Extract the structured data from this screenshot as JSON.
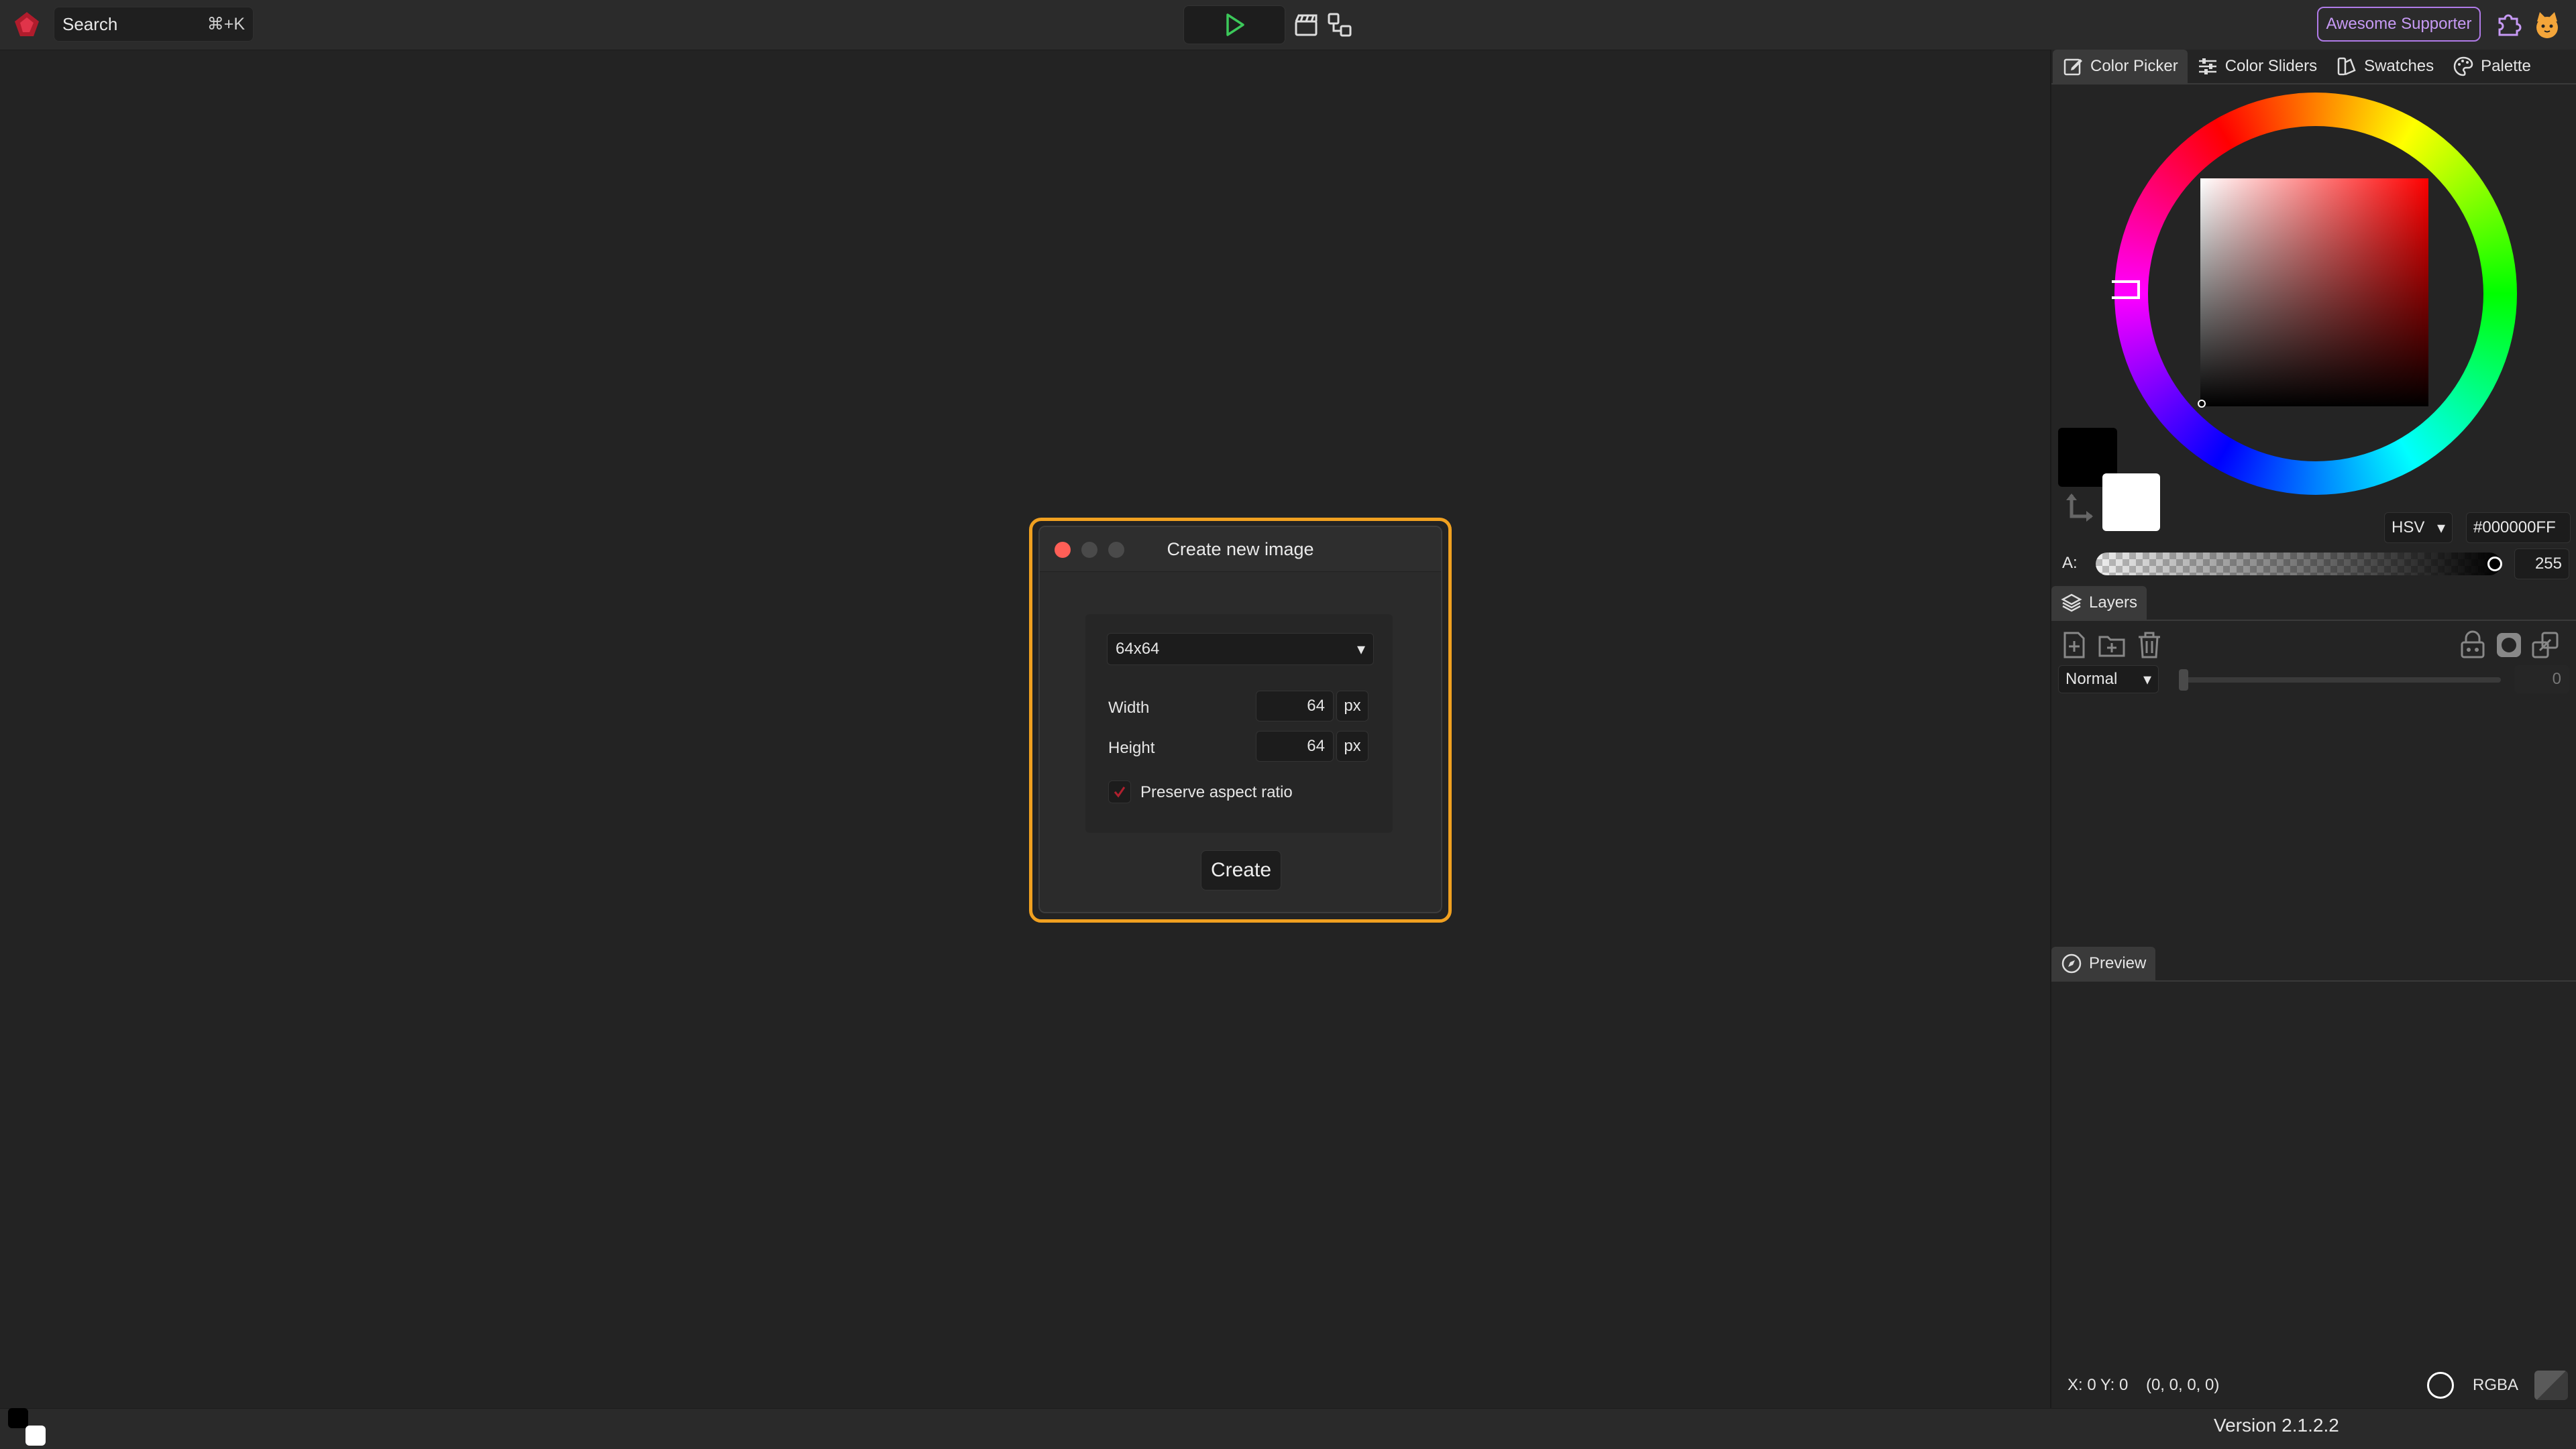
{
  "topbar": {
    "search_placeholder": "Search",
    "search_shortcut": "⌘+K",
    "supporter_label": "Awesome Supporter"
  },
  "color_panel": {
    "tabs": [
      {
        "label": "Color Picker",
        "icon": "edit-icon",
        "active": true
      },
      {
        "label": "Color Sliders",
        "icon": "sliders-icon",
        "active": false
      },
      {
        "label": "Swatches",
        "icon": "swatches-icon",
        "active": false
      },
      {
        "label": "Palette",
        "icon": "palette-icon",
        "active": false
      }
    ],
    "primary_color": "#000000",
    "secondary_color": "#FFFFFF",
    "hue_color": "#FF0000",
    "mode": "HSV",
    "hex": "#000000FF",
    "alpha_label": "A:",
    "alpha_value": "255"
  },
  "layers_panel": {
    "tab_label": "Layers",
    "blend_mode": "Normal",
    "opacity_value": "0"
  },
  "preview_panel": {
    "tab_label": "Preview"
  },
  "status": {
    "coords": "X: 0 Y: 0    (0, 0, 0, 0)",
    "color_mode": "RGBA",
    "version": "Version 2.1.2.2"
  },
  "dialog": {
    "title": "Create new image",
    "preset": "64x64",
    "width_label": "Width",
    "width_value": "64",
    "height_label": "Height",
    "height_value": "64",
    "unit": "px",
    "preserve_label": "Preserve aspect ratio",
    "preserve_checked": true,
    "create_label": "Create"
  },
  "colors": {
    "accent_outline": "#F0A020",
    "close_dot": "#FF5F57",
    "run_green": "#3CC85A",
    "supporter_purple": "#B07BE8"
  }
}
